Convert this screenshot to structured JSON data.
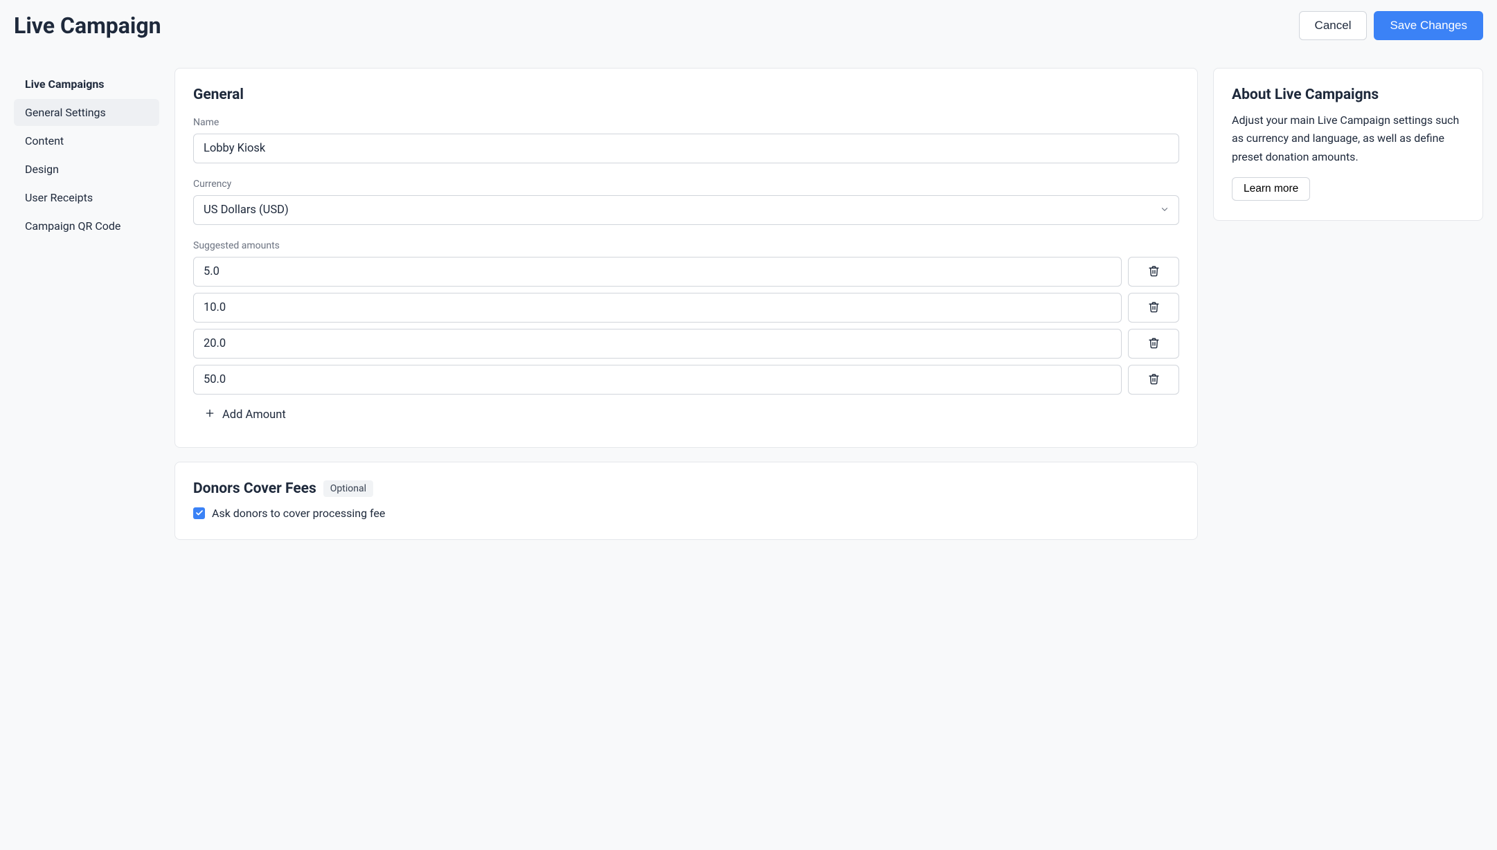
{
  "header": {
    "title": "Live Campaign",
    "cancel": "Cancel",
    "save": "Save Changes"
  },
  "sidebar": {
    "items": [
      {
        "label": "Live Campaigns",
        "header": true
      },
      {
        "label": "General Settings",
        "active": true
      },
      {
        "label": "Content"
      },
      {
        "label": "Design"
      },
      {
        "label": "User Receipts"
      },
      {
        "label": "Campaign QR Code"
      }
    ]
  },
  "general": {
    "heading": "General",
    "name_label": "Name",
    "name_value": "Lobby Kiosk",
    "currency_label": "Currency",
    "currency_value": "US Dollars (USD)",
    "amounts_label": "Suggested amounts",
    "amounts": [
      "5.0",
      "10.0",
      "20.0",
      "50.0"
    ],
    "add_amount": "Add Amount"
  },
  "cover_fees": {
    "heading": "Donors Cover Fees",
    "badge": "Optional",
    "checkbox_label": "Ask donors to cover processing fee",
    "checked": true
  },
  "about": {
    "heading": "About Live Campaigns",
    "body": "Adjust your main Live Campaign settings such as currency and language, as well as define preset donation amounts.",
    "learn_more": "Learn more"
  }
}
